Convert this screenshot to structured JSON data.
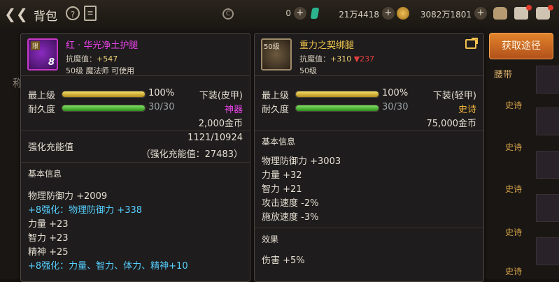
{
  "topbar": {
    "title": "背包",
    "c_icon_text": "C",
    "currency": [
      {
        "value": "0"
      },
      {
        "value": "21万4418"
      },
      {
        "value": "3082万1801"
      }
    ]
  },
  "background": {
    "left_label": "称",
    "tab_label": "腰带",
    "epic_labels": [
      "史诗",
      "史诗",
      "史诗",
      "史诗",
      "史诗"
    ]
  },
  "panel1": {
    "icon_tag": "限",
    "icon_num": "8",
    "name": "红 · 华光净土护腿",
    "resist_label": "抗魔值：",
    "resist_value": "+547",
    "level_line": "50级 魔法师 可使用",
    "max_level_label": "最上级",
    "max_level_pct_value": 1.0,
    "max_level_pct": "100%",
    "slot_type": "下装(皮甲)",
    "durability_label": "耐久度",
    "durability_fill": 1.0,
    "durability_value": "30/30",
    "grade": "神器",
    "price": "2,000金币",
    "reinforce_label": "强化充能值",
    "reinforce_value": "1121/10924",
    "reinforce_note": "（强化充能值：27483）",
    "basic_title": "基本信息",
    "lines": [
      {
        "text": "物理防御力 +2009",
        "cyan": false
      },
      {
        "text": "+8强化：物理防御力 +338",
        "cyan": true
      },
      {
        "text": "力量 +23",
        "cyan": false
      },
      {
        "text": "智力 +23",
        "cyan": false
      },
      {
        "text": "精神 +25",
        "cyan": false
      },
      {
        "text": "+8强化：力量、智力、体力、精神+10",
        "cyan": true
      }
    ]
  },
  "panel2": {
    "icon_level": "50级",
    "name": "重力之契绑腿",
    "resist_label": "抗魔值：",
    "resist_value": "+310",
    "resist_delta": "▼237",
    "level_line": "50级",
    "max_level_label": "最上级",
    "max_level_pct_value": 1.0,
    "max_level_pct": "100%",
    "slot_type": "下装(轻甲)",
    "durability_label": "耐久度",
    "durability_fill": 1.0,
    "durability_value": "30/30",
    "grade": "史诗",
    "price": "75,000金币",
    "basic_title": "基本信息",
    "lines": [
      {
        "text": "物理防御力 +3003"
      },
      {
        "text": "力量 +32"
      },
      {
        "text": "智力 +21"
      },
      {
        "text": "攻击速度 -2%"
      },
      {
        "text": "施放速度 -3%"
      }
    ],
    "effect_title": "效果",
    "effect_lines": [
      {
        "text": "伤害 +5%"
      }
    ]
  },
  "acquire_button": "获取途径",
  "colors": {
    "artifact": "#e743e7",
    "epic": "#f2b53c",
    "enhance": "#56d0ff",
    "accent_button": "#d06a22"
  }
}
